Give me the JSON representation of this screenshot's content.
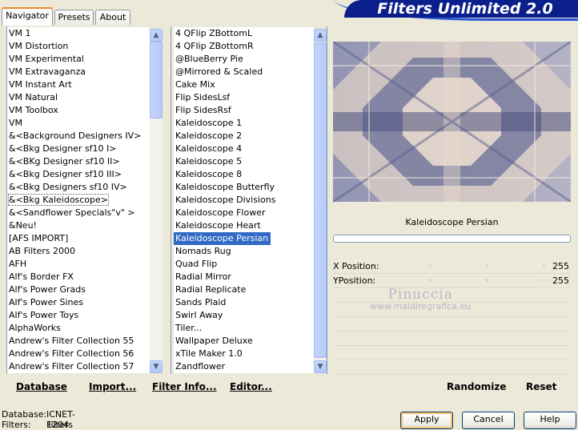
{
  "header": {
    "title": "Filters Unlimited 2.0"
  },
  "tabs": [
    {
      "label": "Navigator",
      "active": true
    },
    {
      "label": "Presets",
      "active": false
    },
    {
      "label": "About",
      "active": false
    }
  ],
  "categories": [
    "VM 1",
    "VM Distortion",
    "VM Experimental",
    "VM Extravaganza",
    "VM Instant Art",
    "VM Natural",
    "VM Toolbox",
    "VM",
    "&<Background Designers IV>",
    "&<Bkg Designer sf10 I>",
    "&<BKg Designer sf10 II>",
    "&<Bkg Designer sf10 III>",
    "&<Bkg Designers sf10 IV>",
    "&<Bkg Kaleidoscope>",
    "&<Sandflower Specials\"v\" >",
    "&Neu!",
    "[AFS IMPORT]",
    "AB Filters 2000",
    "AFH",
    "Alf's Border FX",
    "Alf's Power Grads",
    "Alf's Power Sines",
    "Alf's Power Toys",
    "AlphaWorks",
    "Andrew's Filter Collection 55",
    "Andrew's Filter Collection 56",
    "Andrew's Filter Collection 57"
  ],
  "categories_selected_index": 13,
  "filters": [
    "4 QFlip ZBottomL",
    "4 QFlip ZBottomR",
    "@BlueBerry Pie",
    "@Mirrored & Scaled",
    "Cake Mix",
    "Flip SidesLsf",
    "Flip SidesRsf",
    "Kaleidoscope 1",
    "Kaleidoscope 2",
    "Kaleidoscope 4",
    "Kaleidoscope 5",
    "Kaleidoscope 8",
    "Kaleidoscope Butterfly",
    "Kaleidoscope Divisions",
    "Kaleidoscope Flower",
    "Kaleidoscope Heart",
    "Kaleidoscope Persian",
    "Nomads Rug",
    "Quad Flip",
    "Radial Mirror",
    "Radial Replicate",
    "Sands Plaid",
    "Swirl Away",
    "Tiler...",
    "Wallpaper Deluxe",
    "xTile Maker 1.0",
    "Zandflower"
  ],
  "filters_selected_index": 16,
  "preview": {
    "caption": "Kaleidoscope Persian",
    "progress": 0
  },
  "params": [
    {
      "label": "X Position:",
      "value": "255"
    },
    {
      "label": "YPosition:",
      "value": "255"
    }
  ],
  "watermark": {
    "line1": "Pinuccia",
    "line2": "www.maidiregrafica.eu"
  },
  "links": {
    "database": "Database",
    "import": "Import...",
    "filter_info": "Filter Info...",
    "editor": "Editor...",
    "randomize": "Randomize",
    "reset": "Reset"
  },
  "status": {
    "database_label": "Database:",
    "database_value": "ICNET-Filters",
    "filters_label": "Filters:",
    "filters_value": "1204"
  },
  "buttons": {
    "apply": "Apply",
    "cancel": "Cancel",
    "help": "Help"
  },
  "colors": {
    "selection": "#316ac5",
    "header": "#0a1e8c",
    "dialog": "#ece9d8"
  }
}
